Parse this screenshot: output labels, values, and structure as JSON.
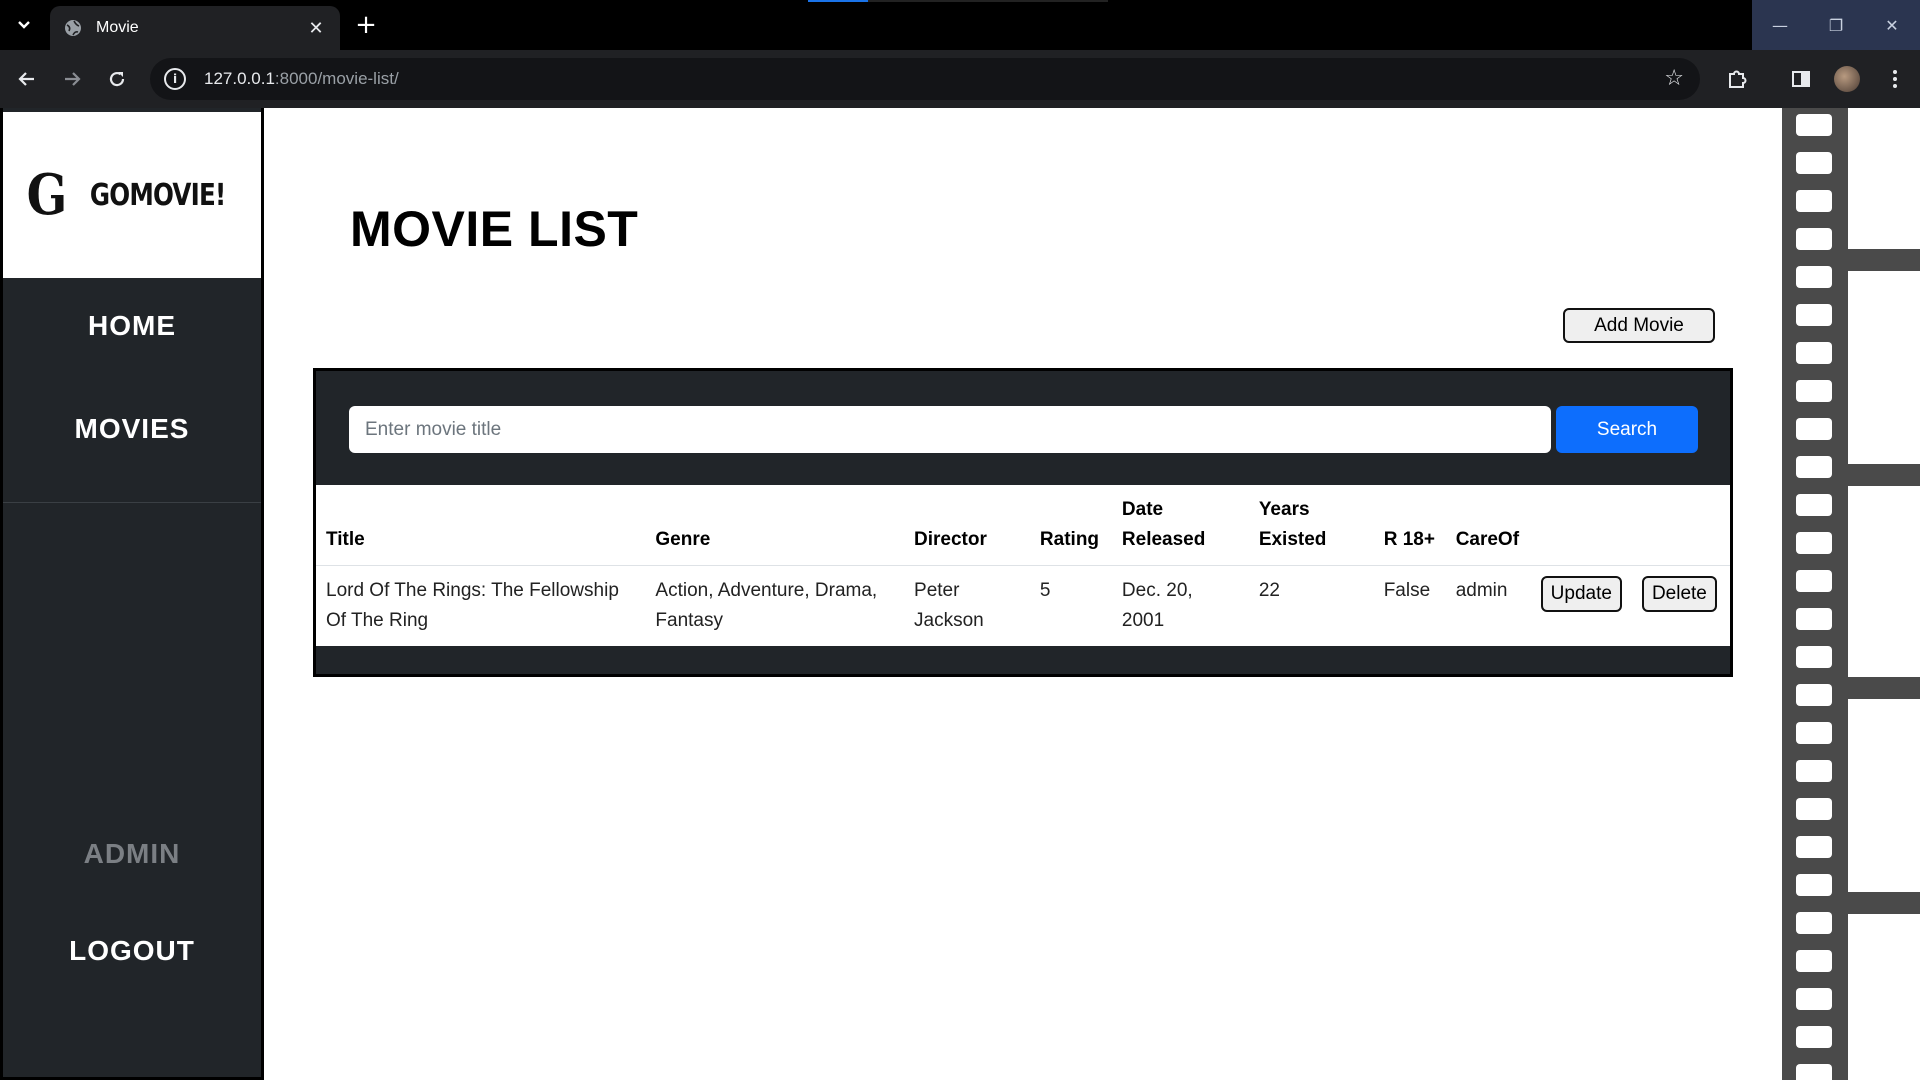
{
  "browser": {
    "tab_title": "Movie",
    "tab_close": "✕",
    "new_tab": "+",
    "url_host": "127.0.0.1",
    "url_path": ":8000/movie-list/",
    "window_controls": {
      "minimize": "—",
      "maximize": "❐",
      "close": "✕"
    }
  },
  "sidebar": {
    "logo_letter": "G",
    "logo_text": "GOMOVIE!",
    "home": "HOME",
    "movies": "MOVIES",
    "admin": "ADMIN",
    "logout": "LOGOUT"
  },
  "main": {
    "title": "MOVIE LIST",
    "add_movie": "Add Movie",
    "search": {
      "placeholder": "Enter movie title",
      "button": "Search"
    },
    "table": {
      "headers": {
        "title": "Title",
        "genre": "Genre",
        "director": "Director",
        "rating": "Rating",
        "date_released": "Date Released",
        "years_existed": "Years Existed",
        "r18": "R 18+",
        "careof": "CareOf"
      },
      "rows": [
        {
          "title": "Lord Of The Rings: The Fellowship Of The Ring",
          "genre": "Action, Adventure, Drama, Fantasy",
          "director": "Peter Jackson",
          "rating": "5",
          "date_released": "Dec. 20, 2001",
          "years_existed": "22",
          "r18": "False",
          "careof": "admin",
          "update": "Update",
          "delete": "Delete"
        }
      ]
    }
  },
  "colors": {
    "sidebar_bg": "#212529",
    "panel_bg": "#212529",
    "search_button": "#0d6efd",
    "admin_link": "#7b7f84"
  },
  "icons": {
    "tab_list": "chevron-down-icon",
    "favicon": "globe-icon",
    "back": "arrow-left-icon",
    "forward": "arrow-right-icon",
    "reload": "reload-icon",
    "site_info": "info-icon",
    "bookmark": "star-icon",
    "extensions": "puzzle-icon",
    "side_panel": "side-panel-icon",
    "menu": "kebab-menu-icon"
  }
}
